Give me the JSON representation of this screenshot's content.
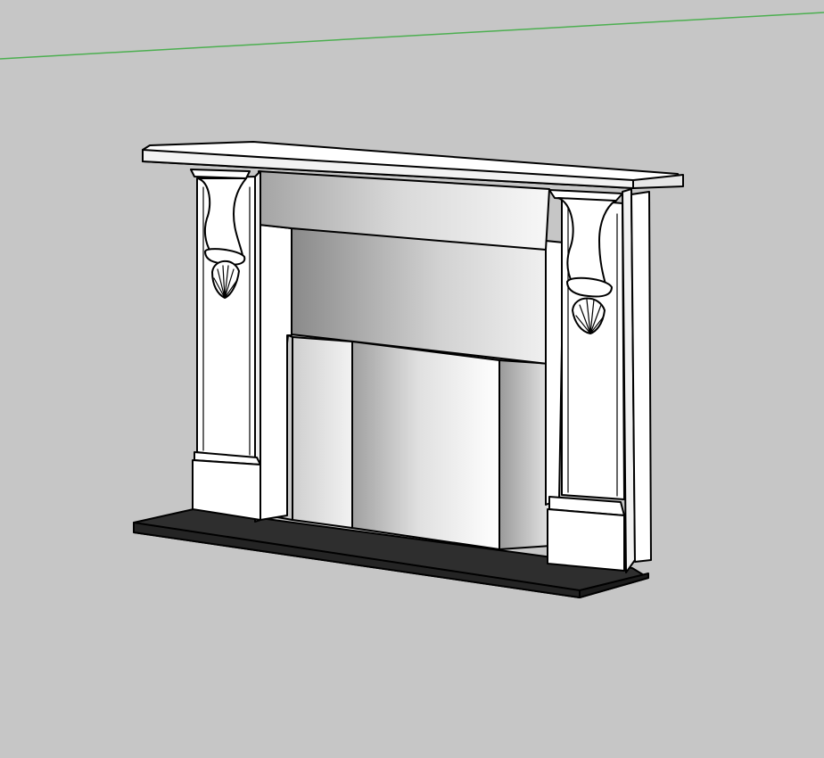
{
  "viewport": {
    "background": "#c6c6c6",
    "axis_color": "#4caf50",
    "model": "fireplace-surround"
  },
  "materials": {
    "marble_white": "#ffffff",
    "hearth_black": "#2e2e2e",
    "edge_black": "#000000"
  }
}
